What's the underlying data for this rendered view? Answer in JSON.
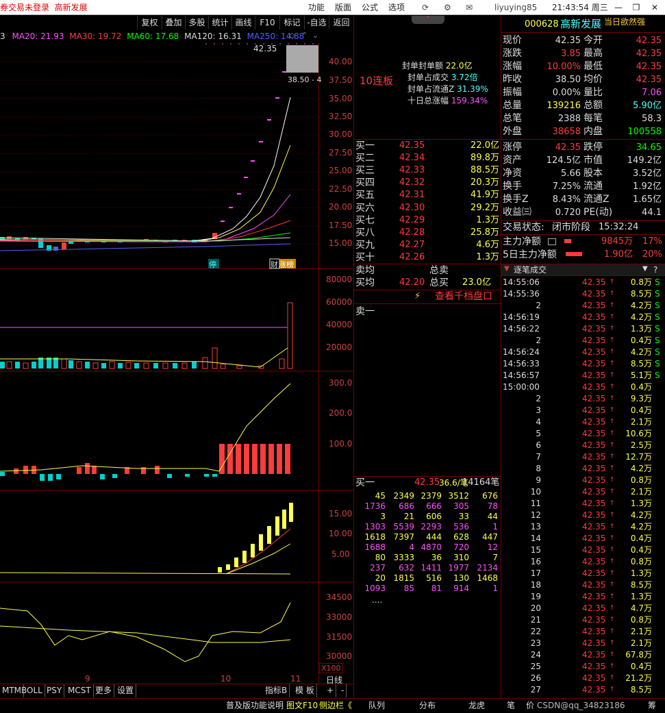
{
  "topbar": {
    "login": "券交易未登录",
    "stock": "高新发展",
    "menu": [
      "功能",
      "版面",
      "公式",
      "选项"
    ],
    "user": "liyuying85",
    "clock": "21:43:54 周三",
    "win_min": "—",
    "win_restore": "❐",
    "win_close": "✕"
  },
  "chart_toolbar": [
    "复权",
    "叠加",
    "多股",
    "统计",
    "画线",
    "F10",
    "标记",
    "-自选",
    "返回"
  ],
  "ma": {
    "ma5": "3",
    "ma20": "MA20: 21.93",
    "ma30": "MA30: 19.72",
    "ma60": "MA60: 17.68",
    "ma120": "MA120: 16.31",
    "ma250": "MA250: 14.88"
  },
  "chart_labels": {
    "high_mark": "42.35",
    "low_mark": "38.50 - 4",
    "tag_stop": "停",
    "tag_cai": "财",
    "tag_zt": "涨榜",
    "x_sep": "9",
    "x_10": "10",
    "x_11": "11",
    "x100": "X100",
    "period": "日线"
  },
  "axis": {
    "price": [
      "40.00",
      "37.50",
      "35.00",
      "32.50",
      "30.00",
      "27.50",
      "25.00",
      "22.50",
      "20.00",
      "17.50",
      "15.00"
    ],
    "vol": [
      "80000",
      "60000",
      "40000",
      "20000"
    ],
    "ind1": [
      "300.0",
      "200.0",
      "100.0"
    ],
    "ind2": [
      "15.00",
      "10.00",
      "5.00"
    ],
    "ind3": [
      "34500",
      "33000",
      "31500",
      "30000"
    ]
  },
  "bottom_tabs": [
    "MTM",
    "BOLL",
    "PSY",
    "MCST",
    "更多",
    "设置"
  ],
  "bottom_right": [
    "指标B",
    "模 板",
    "+",
    "-"
  ],
  "status": {
    "a": "普及版功能说明",
    "b": "图文F10",
    "c": "侧边栏《",
    "d": "队列",
    "e": "分布",
    "f": "龙虎",
    "g": "笔",
    "h": "价",
    "i": "CSDN@qq_34823186",
    "j": "筹"
  },
  "seal": {
    "title": "10连板",
    "rows": [
      {
        "k": "封单封单额",
        "v": "22.0亿"
      },
      {
        "k": "封单占成交",
        "v": "3.72倍"
      },
      {
        "k": "封单占流通Z",
        "v": "31.39%"
      },
      {
        "k": "十日总涨幅",
        "v": "159.34%"
      }
    ]
  },
  "bids": [
    {
      "n": "买一",
      "p": "42.35",
      "v": "22.0亿"
    },
    {
      "n": "买二",
      "p": "42.34",
      "v": "89.8万"
    },
    {
      "n": "买三",
      "p": "42.33",
      "v": "88.5万"
    },
    {
      "n": "买四",
      "p": "42.32",
      "v": "20.3万"
    },
    {
      "n": "买五",
      "p": "42.31",
      "v": "41.9万"
    },
    {
      "n": "买六",
      "p": "42.30",
      "v": "29.2万"
    },
    {
      "n": "买七",
      "p": "42.29",
      "v": "1.3万"
    },
    {
      "n": "买八",
      "p": "42.28",
      "v": "25.8万"
    },
    {
      "n": "买九",
      "p": "42.27",
      "v": "4.6万"
    },
    {
      "n": "买十",
      "p": "42.26",
      "v": "1.3万"
    }
  ],
  "avg": {
    "sell_avg": "卖均",
    "total_sell": "总卖",
    "buy_avg": "买均",
    "buy_avg_v": "42.20",
    "total_buy": "总买",
    "total_buy_v": "23.0亿",
    "view1000": "查看千档盘口",
    "sell1": "卖一"
  },
  "queue": {
    "label": "买一",
    "price": "42.35",
    "info": "36.6/笔",
    "count": "14164笔",
    "rows": [
      [
        "45",
        "2349",
        "2379",
        "3512",
        "676"
      ],
      [
        "1736",
        "686",
        "666",
        "305",
        "78"
      ],
      [
        "3",
        "21",
        "606",
        "33",
        "44"
      ],
      [
        "1303",
        "5539",
        "2293",
        "536",
        "1"
      ],
      [
        "1618",
        "7397",
        "444",
        "628",
        "447"
      ],
      [
        "1688",
        "4",
        "4870",
        "720",
        "12"
      ],
      [
        "80",
        "3333",
        "36",
        "310",
        "7"
      ],
      [
        "237",
        "632",
        "1411",
        "1977",
        "2134"
      ],
      [
        "20",
        "1815",
        "516",
        "130",
        "1468"
      ],
      [
        "1093",
        "85",
        "81",
        "914",
        "1"
      ]
    ],
    "more": "...."
  },
  "quote": {
    "code": "000628",
    "name": "高新发展",
    "badge": "当日欲然强",
    "rows": [
      [
        "现价",
        "42.35",
        "今开",
        "42.35"
      ],
      [
        "涨跌",
        "3.85",
        "最高",
        "42.35"
      ],
      [
        "涨幅",
        "10.00%",
        "最低",
        "42.35"
      ],
      [
        "昨收",
        "38.50",
        "均价",
        "42.35"
      ],
      [
        "振幅",
        "0.00%",
        "量比",
        "7.06"
      ],
      [
        "总量",
        "139216",
        "总额",
        "5.90亿"
      ],
      [
        "总笔",
        "2388",
        "每笔",
        "58.3"
      ],
      [
        "外盘",
        "38658",
        "内盘",
        "100558"
      ]
    ],
    "rows2": [
      [
        "涨停",
        "42.35",
        "跌停",
        "34.65"
      ],
      [
        "资产",
        "124.5亿",
        "市值",
        "149.2亿"
      ],
      [
        "净资",
        "5.66",
        "股本",
        "3.52亿"
      ],
      [
        "换手",
        "7.25%",
        "流通",
        "1.92亿"
      ],
      [
        "换手Z",
        "8.43%",
        "流通Z",
        "1.65亿"
      ],
      [
        "收益㈢",
        "0.720",
        "PE(动)",
        "44.1"
      ]
    ],
    "state_label": "交易状态:",
    "state": "闭市阶段",
    "state_time": "15:32:24",
    "main_label": "主力净额",
    "main_v": "9845万",
    "main_p": "17%",
    "main5_label": "5日主力净额",
    "main5_v": "1.90亿",
    "main5_p": "20%"
  },
  "ticks_title": "逐笔成交",
  "ticks": [
    [
      "14:55:06",
      "42.35",
      "0.8万",
      "S"
    ],
    [
      "14:55:36",
      "42.35",
      "8.5万",
      "S"
    ],
    [
      "2",
      "42.35",
      "4.2万",
      "S"
    ],
    [
      "14:56:19",
      "42.35",
      "4.2万",
      "S"
    ],
    [
      "14:56:22",
      "42.35",
      "1.3万",
      "S"
    ],
    [
      "2",
      "42.35",
      "0.4万",
      "S"
    ],
    [
      "14:56:24",
      "42.35",
      "4.2万",
      "S"
    ],
    [
      "14:56:33",
      "42.35",
      "8.5万",
      "S"
    ],
    [
      "14:56:57",
      "42.35",
      "5.1万",
      "S"
    ],
    [
      "15:00:00",
      "42.35",
      "0.4万",
      ""
    ],
    [
      "2",
      "42.35",
      "9.3万",
      ""
    ],
    [
      "3",
      "42.35",
      "0.4万",
      ""
    ],
    [
      "4",
      "42.35",
      "2.1万",
      ""
    ],
    [
      "5",
      "42.35",
      "10.6万",
      ""
    ],
    [
      "6",
      "42.35",
      "2.5万",
      ""
    ],
    [
      "7",
      "42.35",
      "12.7万",
      ""
    ],
    [
      "8",
      "42.35",
      "4.2万",
      ""
    ],
    [
      "9",
      "42.35",
      "0.8万",
      ""
    ],
    [
      "10",
      "42.35",
      "2.1万",
      ""
    ],
    [
      "11",
      "42.35",
      "1.3万",
      ""
    ],
    [
      "12",
      "42.35",
      "4.2万",
      ""
    ],
    [
      "13",
      "42.35",
      "4.2万",
      ""
    ],
    [
      "14",
      "42.35",
      "0.4万",
      ""
    ],
    [
      "15",
      "42.35",
      "0.4万",
      ""
    ],
    [
      "16",
      "42.35",
      "0.8万",
      ""
    ],
    [
      "17",
      "42.35",
      "1.3万",
      ""
    ],
    [
      "18",
      "42.35",
      "8.5万",
      ""
    ],
    [
      "19",
      "42.35",
      "1.3万",
      ""
    ],
    [
      "20",
      "42.35",
      "4.7万",
      ""
    ],
    [
      "21",
      "42.35",
      "0.8万",
      ""
    ],
    [
      "22",
      "42.35",
      "2.1万",
      ""
    ],
    [
      "23",
      "42.35",
      "2.1万",
      ""
    ],
    [
      "24",
      "42.35",
      "67.8万",
      ""
    ],
    [
      "25",
      "42.35",
      "0.4万",
      ""
    ],
    [
      "26",
      "42.35",
      "21.2万",
      ""
    ],
    [
      "27",
      "42.35",
      "8.5万",
      ""
    ]
  ]
}
